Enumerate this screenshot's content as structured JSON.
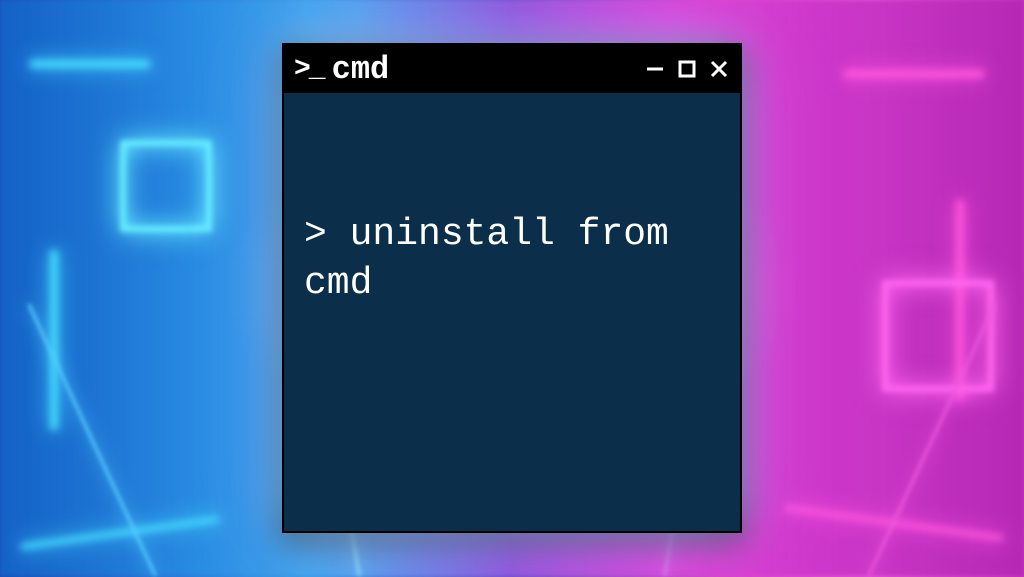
{
  "window": {
    "title": "cmd",
    "prompt_icon_text": ">_"
  },
  "terminal": {
    "prompt": ">",
    "command": "uninstall from cmd",
    "full_line": "> uninstall from cmd"
  },
  "colors": {
    "terminal_bg": "#0b2e4a",
    "titlebar_bg": "#000000",
    "text": "#ffffff"
  }
}
